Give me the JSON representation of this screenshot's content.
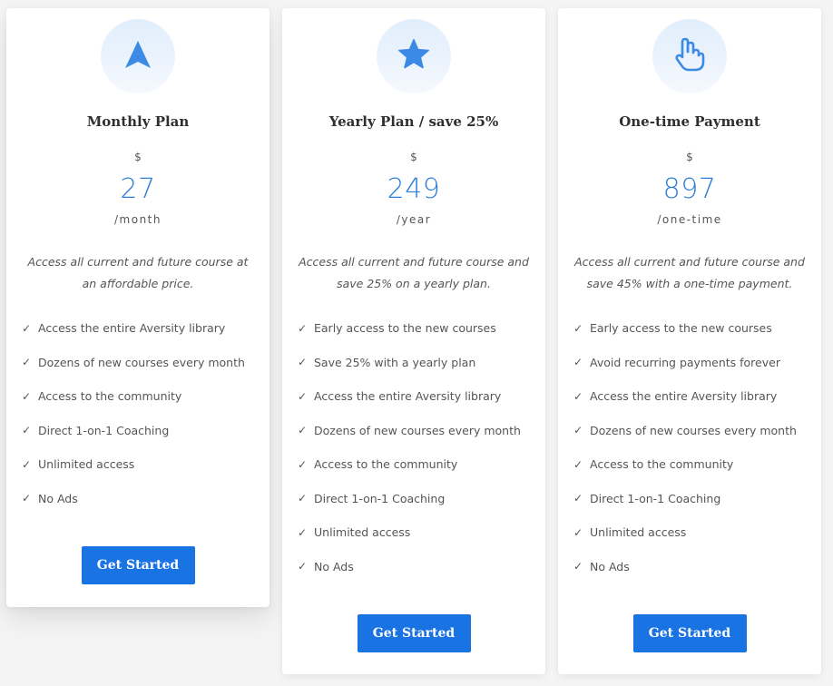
{
  "plans": [
    {
      "icon": "arrow-up-icon",
      "title": "Monthly Plan",
      "currency": "$",
      "price": "27",
      "period": "/month",
      "description": "Access all current and future course at an affordable price.",
      "features": [
        "Access the entire Aversity library",
        "Dozens of new courses every month",
        "Access to the community",
        "Direct 1-on-1 Coaching",
        "Unlimited access",
        "No Ads"
      ],
      "button_label": "Get Started"
    },
    {
      "icon": "star-icon",
      "title": "Yearly Plan / save 25%",
      "currency": "$",
      "price": "249",
      "period": "/year",
      "description": "Access all current and future course and save 25% on a yearly plan.",
      "features": [
        "Early access to the new courses",
        "Save 25% with a yearly plan",
        "Access the entire Aversity library",
        "Dozens of new courses every month",
        "Access to the community",
        "Direct 1-on-1 Coaching",
        "Unlimited access",
        "No Ads"
      ],
      "button_label": "Get Started"
    },
    {
      "icon": "hand-peace-icon",
      "title": "One-time Payment",
      "currency": "$",
      "price": "897",
      "period": "/one-time",
      "description": "Access all current and future course and save 45% with a one-time payment.",
      "features": [
        "Early access to the new courses",
        "Avoid recurring payments forever",
        "Access the entire Aversity library",
        "Dozens of new courses every month",
        "Access to the community",
        "Direct 1-on-1 Coaching",
        "Unlimited access",
        "No Ads"
      ],
      "button_label": "Get Started"
    }
  ],
  "colors": {
    "accent": "#1a73e2",
    "price": "#2f7fd6",
    "icon": "#3a8ae6"
  }
}
